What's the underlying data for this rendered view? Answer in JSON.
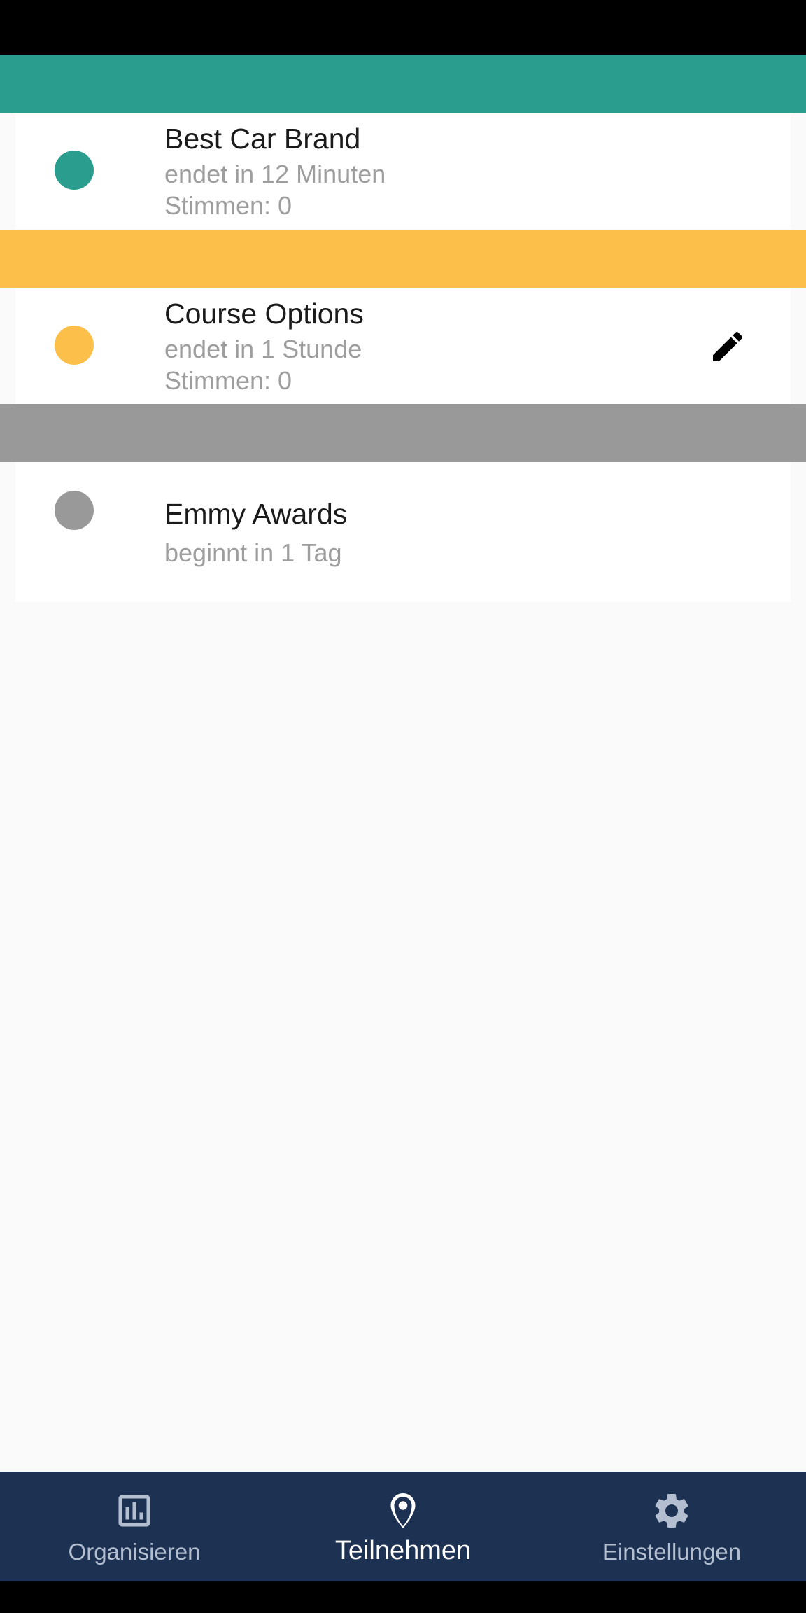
{
  "colors": {
    "active": "#2a9d8f",
    "upcoming": "#fcbf49",
    "inactive": "#999999",
    "nav_bg": "#1d3252"
  },
  "polls": [
    {
      "status": "active",
      "title": "Best Car Brand",
      "line1": "endet in 12 Minuten",
      "line2": "Stimmen: 0",
      "editable": false
    },
    {
      "status": "upcoming",
      "title": "Course Options",
      "line1": "endet in 1 Stunde",
      "line2": "Stimmen: 0",
      "editable": true,
      "edit_icon": "pencil-icon"
    },
    {
      "status": "inactive",
      "title": "Emmy Awards",
      "line1": "beginnt in 1 Tag",
      "editable": false
    }
  ],
  "bottom_nav": {
    "items": [
      {
        "label": "Organisieren",
        "icon": "bar-chart-icon",
        "active": false
      },
      {
        "label": "Teilnehmen",
        "icon": "location-pin-icon",
        "active": true
      },
      {
        "label": "Einstellungen",
        "icon": "gear-icon",
        "active": false
      }
    ]
  }
}
